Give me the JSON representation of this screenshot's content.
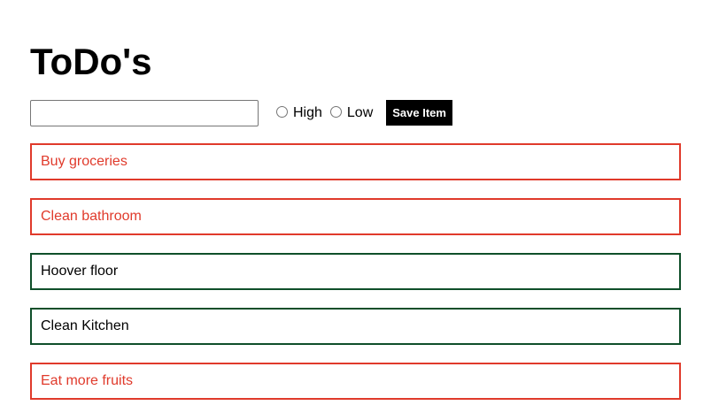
{
  "title": "ToDo's",
  "form": {
    "input_value": "",
    "input_placeholder": "",
    "priority_options": [
      {
        "label": "High",
        "checked": false
      },
      {
        "label": "Low",
        "checked": false
      }
    ],
    "save_label": "Save Item"
  },
  "colors": {
    "high_priority": "#e03a2b",
    "low_priority_border": "#0f4f2a",
    "button_bg": "#000000"
  },
  "todos": [
    {
      "text": "Buy groceries",
      "priority": "high"
    },
    {
      "text": "Clean bathroom",
      "priority": "high"
    },
    {
      "text": "Hoover floor",
      "priority": "low"
    },
    {
      "text": "Clean Kitchen",
      "priority": "low"
    },
    {
      "text": "Eat more fruits",
      "priority": "high"
    }
  ]
}
